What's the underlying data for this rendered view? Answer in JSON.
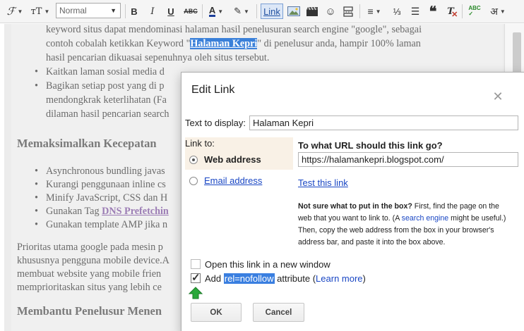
{
  "toolbar": {
    "format_select": "Normal",
    "link_label": "Link",
    "devanagari_label": "अ"
  },
  "editor": {
    "para1": [
      "keyword situs dapat mendominasi halaman hasil penelusuran search engine \"google\", sebagai",
      "contoh cobalah ketikkan Keyword \"",
      "Halaman Kepri",
      "\" di penelusur anda, hampir 100% laman",
      "hasil pencarian dikuasai sepenuhnya oleh situs tersebut."
    ],
    "bullets1": [
      "Kaitkan laman sosial media d",
      "Bagikan setiap post yang di p",
      "mendongkrak keterlihatan (Fa",
      "dilaman hasil pencarian search"
    ],
    "heading1": "Memaksimalkan Kecepatan",
    "bullets2": [
      "Asynchronous bundling javas",
      "Kurangi penggunaan inline cs",
      "Minify JavaScript, CSS dan H",
      "Gunakan Tag ",
      "DNS Prefetchin",
      "Gunakan template AMP jika n"
    ],
    "para2": [
      "Prioritas utama google pada mesin p",
      "khususnya pengguna mobile device.A",
      "membuat website yang mobile frien",
      "memprioritaskan situs yang lebih ce"
    ],
    "heading2": "Membantu Penelusur Menen"
  },
  "dialog": {
    "title": "Edit Link",
    "text_to_display_label": "Text to display:",
    "text_to_display_value": "Halaman Kepri",
    "link_to_label": "Link to:",
    "web_address_label": "Web address",
    "email_address_label": "Email address",
    "url_question": "To what URL should this link go?",
    "url_value": "https://halamankepri.blogspot.com/",
    "test_link_label": "Test this link",
    "hint_bold": "Not sure what to put in the box?",
    "hint_1": " First, find the page on the",
    "hint_2": "web that you want to link to. (A ",
    "hint_search": "search engine",
    "hint_3": " might be useful.)",
    "hint_4": "Then, copy the web address from the box in your browser's",
    "hint_5": "address bar, and paste it into the box above.",
    "open_new_window_label": "Open this link in a new window",
    "open_new_window_checked": false,
    "add_label": "Add",
    "rel_nofollow": "rel=nofollow",
    "attribute_label": " attribute (",
    "learn_more_label": "Learn more",
    "close_paren": ")",
    "nofollow_checked": true,
    "ok_label": "OK",
    "cancel_label": "Cancel"
  },
  "colors": {
    "accent": "#1a47c4",
    "selection": "#3a80d9",
    "arrow_green": "#2aa83a"
  }
}
